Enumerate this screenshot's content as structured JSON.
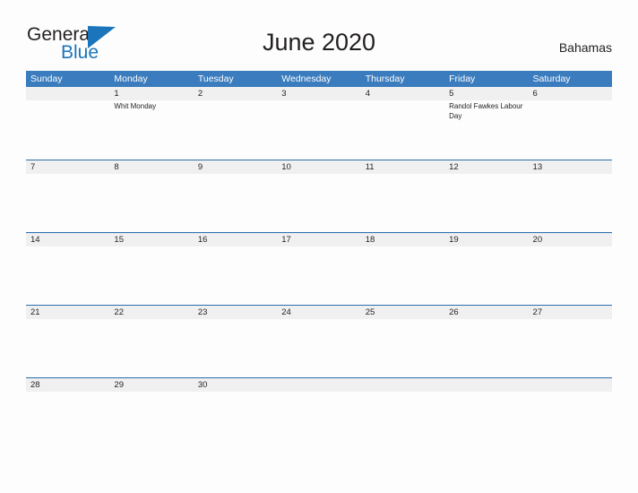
{
  "branding": {
    "logo_general": "General",
    "logo_blue": "Blue",
    "logo_flag_icon": "blue-triangle-flag-icon"
  },
  "header": {
    "title": "June 2020",
    "country": "Bahamas"
  },
  "calendar": {
    "weekdays": [
      "Sunday",
      "Monday",
      "Tuesday",
      "Wednesday",
      "Thursday",
      "Friday",
      "Saturday"
    ],
    "colors": {
      "header_blue": "#3a7cbe",
      "row_rule_blue": "#2a6daf",
      "daynum_strip_gray": "#f0f0f0",
      "text": "#231f20",
      "logo_blue": "#1b75bb",
      "page_background": "#fdfdfd"
    },
    "weeks": [
      {
        "days": [
          {
            "num": "",
            "events": []
          },
          {
            "num": "1",
            "events": [
              "Whit Monday"
            ]
          },
          {
            "num": "2",
            "events": []
          },
          {
            "num": "3",
            "events": []
          },
          {
            "num": "4",
            "events": []
          },
          {
            "num": "5",
            "events": [
              "Randol Fawkes Labour Day"
            ]
          },
          {
            "num": "6",
            "events": []
          }
        ]
      },
      {
        "days": [
          {
            "num": "7",
            "events": []
          },
          {
            "num": "8",
            "events": []
          },
          {
            "num": "9",
            "events": []
          },
          {
            "num": "10",
            "events": []
          },
          {
            "num": "11",
            "events": []
          },
          {
            "num": "12",
            "events": []
          },
          {
            "num": "13",
            "events": []
          }
        ]
      },
      {
        "days": [
          {
            "num": "14",
            "events": []
          },
          {
            "num": "15",
            "events": []
          },
          {
            "num": "16",
            "events": []
          },
          {
            "num": "17",
            "events": []
          },
          {
            "num": "18",
            "events": []
          },
          {
            "num": "19",
            "events": []
          },
          {
            "num": "20",
            "events": []
          }
        ]
      },
      {
        "days": [
          {
            "num": "21",
            "events": []
          },
          {
            "num": "22",
            "events": []
          },
          {
            "num": "23",
            "events": []
          },
          {
            "num": "24",
            "events": []
          },
          {
            "num": "25",
            "events": []
          },
          {
            "num": "26",
            "events": []
          },
          {
            "num": "27",
            "events": []
          }
        ]
      },
      {
        "days": [
          {
            "num": "28",
            "events": []
          },
          {
            "num": "29",
            "events": []
          },
          {
            "num": "30",
            "events": []
          },
          {
            "num": "",
            "events": []
          },
          {
            "num": "",
            "events": []
          },
          {
            "num": "",
            "events": []
          },
          {
            "num": "",
            "events": []
          }
        ]
      }
    ]
  }
}
